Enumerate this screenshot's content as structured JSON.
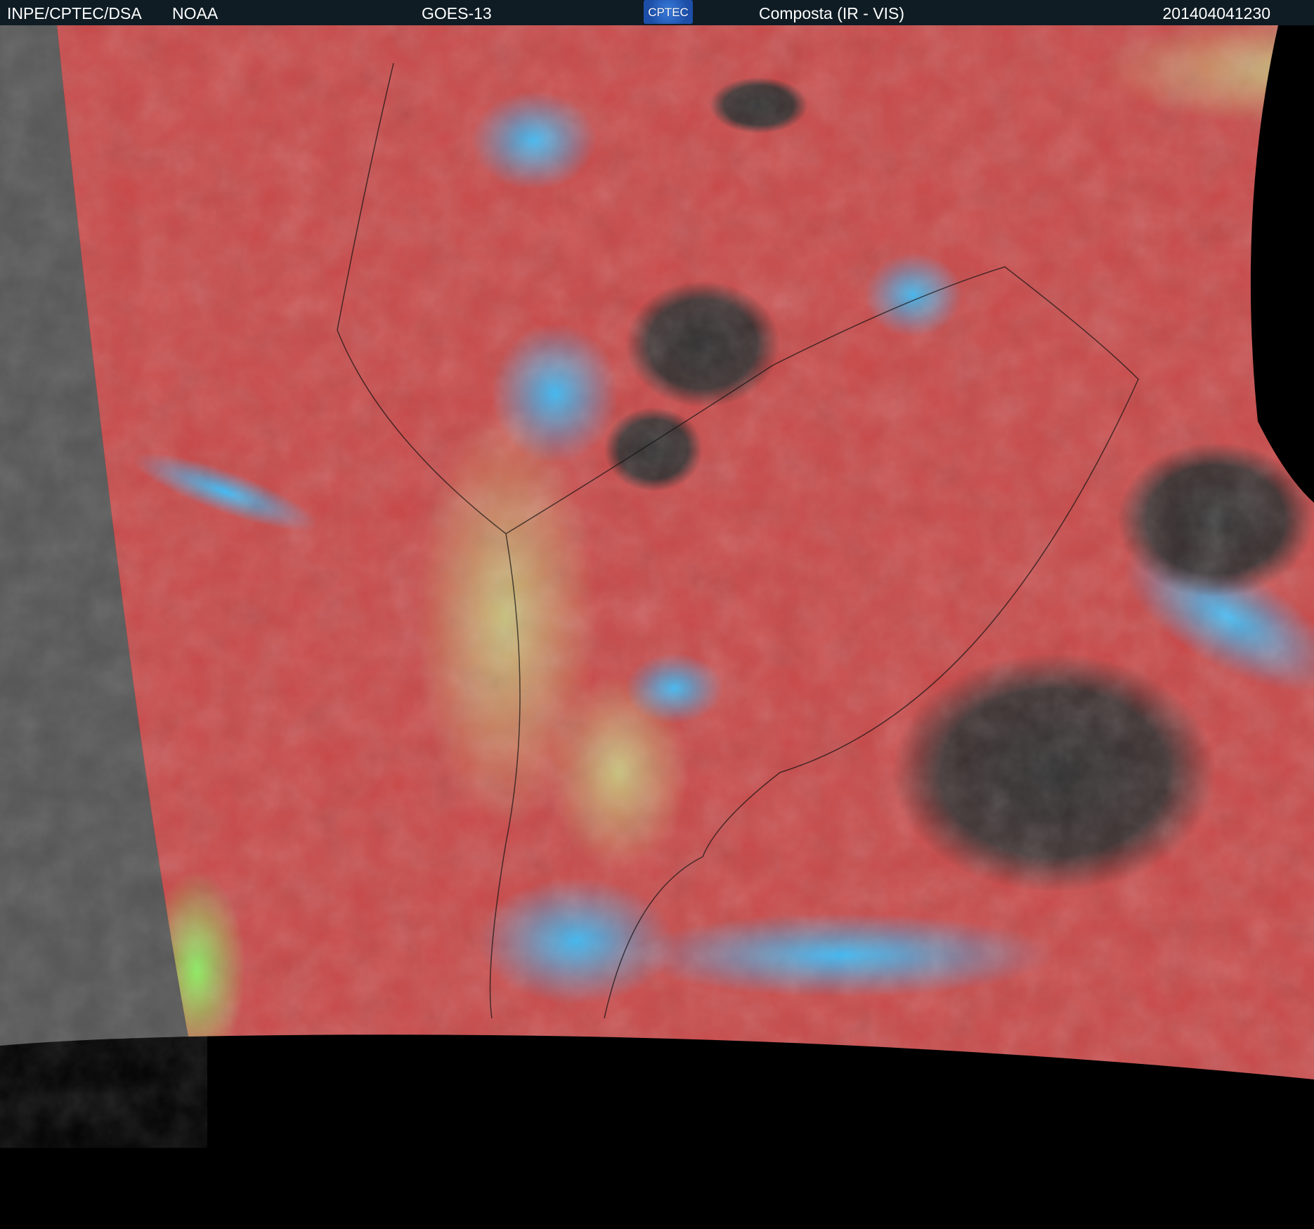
{
  "header": {
    "agency": "INPE/CPTEC/DSA",
    "partner": "NOAA",
    "satellite": "GOES-13",
    "logo_text": "CPTEC",
    "product": "Composta (IR - VIS)",
    "timestamp": "201404041230"
  },
  "colors": {
    "header_bg": "#0f1c24",
    "land_ocean_red": "#c84848",
    "cloud_blue": "#3aaaf0",
    "clear_dark": "#2c2c2c",
    "low_cloud_yellow": "#b8b070",
    "outside_gray": "#555555"
  }
}
